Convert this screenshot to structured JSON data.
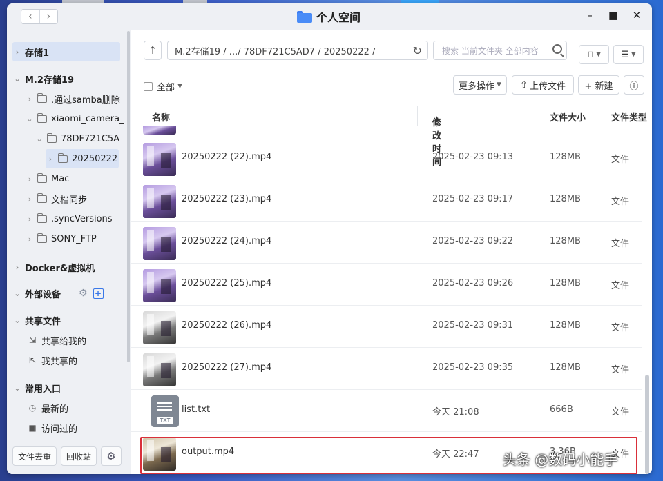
{
  "window": {
    "title": "个人空间"
  },
  "sidebar": {
    "items": [
      {
        "label": "存储1"
      },
      {
        "label": "M.2存储19"
      },
      {
        "label": ".通过samba删除"
      },
      {
        "label": "xiaomi_camera_"
      },
      {
        "label": "78DF721C5A"
      },
      {
        "label": "20250222"
      },
      {
        "label": "Mac"
      },
      {
        "label": "文档同步"
      },
      {
        "label": ".syncVersions"
      },
      {
        "label": "SONY_FTP"
      },
      {
        "label": "Docker&虚拟机"
      },
      {
        "label": "外部设备"
      },
      {
        "label": "共享文件"
      },
      {
        "label": "共享给我的"
      },
      {
        "label": "我共享的"
      },
      {
        "label": "常用入口"
      },
      {
        "label": "最新的"
      },
      {
        "label": "访问过的"
      }
    ],
    "footer": {
      "dedupe": "文件去重",
      "recycle": "回收站"
    }
  },
  "toolbar": {
    "path": "M.2存储19 / .../ 78DF721C5AD7 / 20250222 /",
    "search_placeholder": "搜索 当前文件夹 全部内容",
    "select_all": "全部",
    "more_ops": "更多操作",
    "upload": "上传文件",
    "new": "+ 新建"
  },
  "table": {
    "headers": {
      "name": "名称",
      "modified": "修改时间",
      "size": "文件大小",
      "type": "文件类型"
    },
    "rows": [
      {
        "name": "20250222 (22).mp4",
        "modified": "2025-02-23 09:13",
        "size": "128MB",
        "type": "文件",
        "thumb": "color"
      },
      {
        "name": "20250222 (23).mp4",
        "modified": "2025-02-23 09:17",
        "size": "128MB",
        "type": "文件",
        "thumb": "color"
      },
      {
        "name": "20250222 (24).mp4",
        "modified": "2025-02-23 09:22",
        "size": "128MB",
        "type": "文件",
        "thumb": "color"
      },
      {
        "name": "20250222 (25).mp4",
        "modified": "2025-02-23 09:26",
        "size": "128MB",
        "type": "文件",
        "thumb": "color"
      },
      {
        "name": "20250222 (26).mp4",
        "modified": "2025-02-23 09:31",
        "size": "128MB",
        "type": "文件",
        "thumb": "gray"
      },
      {
        "name": "20250222 (27).mp4",
        "modified": "2025-02-23 09:35",
        "size": "128MB",
        "type": "文件",
        "thumb": "gray"
      },
      {
        "name": "list.txt",
        "modified": "今天 21:08",
        "size": "666B",
        "type": "文件",
        "thumb": "txt"
      },
      {
        "name": "output.mp4",
        "modified": "今天 22:47",
        "size": "3.36B",
        "type": "文件",
        "thumb": "output"
      }
    ]
  },
  "watermark": "头条 @数码小能手",
  "colors": {
    "accent": "#3a78e8",
    "highlight": "#d9303a",
    "sidebar_bg": "#eef0f4"
  }
}
